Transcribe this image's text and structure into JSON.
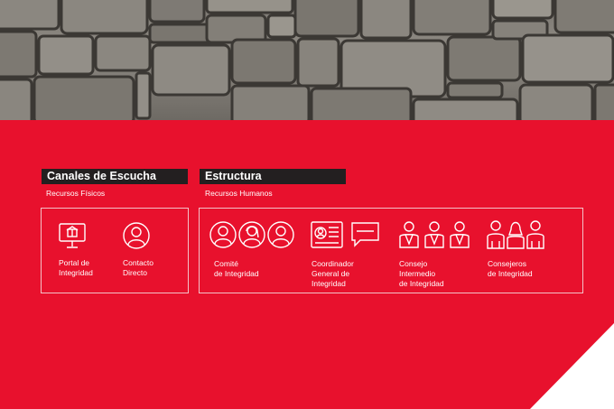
{
  "colors": {
    "red": "#e8112d",
    "dark": "#231f20",
    "white": "#ffffff"
  },
  "canales": {
    "title": "Canales de Escucha",
    "subtitle": "Recursos Físicos",
    "items": [
      {
        "label": "Portal de\nIntegridad",
        "icon": "monitor-icon"
      },
      {
        "label": "Contacto\nDirecto",
        "icon": "person-circle-icon"
      }
    ]
  },
  "estructura": {
    "title": "Estructura",
    "subtitle": "Recursos Humanos",
    "items": [
      {
        "label": "Comité\nde Integridad",
        "icon": "three-people-circles-icon"
      },
      {
        "label": "Coordinador\nGeneral de\nIntegridad",
        "icon": "id-card-and-speech-bubble-icon"
      },
      {
        "label": "Consejo\nIntermedio\nde Integridad",
        "icon": "three-people-suits-icon"
      },
      {
        "label": "Consejeros\nde Integridad",
        "icon": "three-people-icon"
      }
    ]
  }
}
